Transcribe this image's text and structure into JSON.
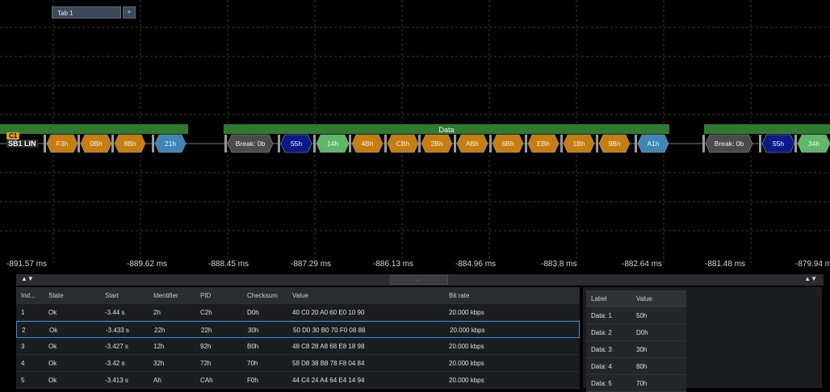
{
  "tabs": {
    "tab1_label": "Tab 1",
    "add_label": "+"
  },
  "channel": {
    "badge": "C1",
    "label": "SB1 LIN"
  },
  "colors": {
    "orange": "#c87d10",
    "blue": "#3f86b8",
    "green": "#2f7a2f",
    "light_green": "#5db86a",
    "navy": "#0a1a8a",
    "gray": "#4b4b4b"
  },
  "bus": {
    "frame_headers": [
      {
        "label": ""
      },
      {
        "label": "Data"
      },
      {
        "label": ""
      }
    ],
    "segments": [
      {
        "text": "F3h",
        "color": "orange"
      },
      {
        "text": "0Bh",
        "color": "orange"
      },
      {
        "text": "8Bh",
        "color": "orange"
      },
      {
        "text": "21h",
        "color": "blue"
      },
      {
        "text": "Break: 0b",
        "color": "gray"
      },
      {
        "text": "55h",
        "color": "navy"
      },
      {
        "text": "14h",
        "color": "light_green"
      },
      {
        "text": "4Bh",
        "color": "orange"
      },
      {
        "text": "CBh",
        "color": "orange"
      },
      {
        "text": "2Bh",
        "color": "orange"
      },
      {
        "text": "ABh",
        "color": "orange"
      },
      {
        "text": "6Bh",
        "color": "orange"
      },
      {
        "text": "EBh",
        "color": "orange"
      },
      {
        "text": "1Bh",
        "color": "orange"
      },
      {
        "text": "9Bh",
        "color": "orange"
      },
      {
        "text": "A1h",
        "color": "blue"
      },
      {
        "text": "Break: 0b",
        "color": "gray"
      },
      {
        "text": "55h",
        "color": "navy"
      },
      {
        "text": "34h",
        "color": "light_green"
      }
    ]
  },
  "time_ticks": [
    "-891.57 ms",
    "-889.62 ms",
    "-888.45 ms",
    "-887.29 ms",
    "-886.13 ms",
    "-884.96 ms",
    "-883.8 ms",
    "-882.64 ms",
    "-881.48 ms",
    "-879.94 ms"
  ],
  "results_table": {
    "columns": [
      "Ind...",
      "State",
      "Start",
      "Identifier",
      "PID",
      "Checksum",
      "Value",
      "Bit rate"
    ],
    "rows": [
      [
        "1",
        "Ok",
        "-3.44 s",
        "2h",
        "C2h",
        "D0h",
        "40 C0 20 A0 60 E0 10 90",
        "20.000 kbps"
      ],
      [
        "2",
        "Ok",
        "-3.433 s",
        "22h",
        "22h",
        "30h",
        "50 D0 30 B0 70 F0 08 88",
        "20.000 kbps"
      ],
      [
        "3",
        "Ok",
        "-3.427 s",
        "12h",
        "92h",
        "B0h",
        "48 C8 28 A8 68 E8 18 98",
        "20.000 kbps"
      ],
      [
        "4",
        "Ok",
        "-3.42 s",
        "32h",
        "72h",
        "70h",
        "58 D8 38 B8 78 F8 04 84",
        "20.000 kbps"
      ],
      [
        "5",
        "Ok",
        "-3.413 s",
        "Ah",
        "CAh",
        "F0h",
        "44 C4 24 A4 64 E4 14 94",
        "20.000 kbps"
      ]
    ],
    "selected_row": 2
  },
  "detail_table": {
    "columns": [
      "Label",
      "Value"
    ],
    "rows": [
      [
        "Data: 1",
        "50h"
      ],
      [
        "Data: 2",
        "D0h"
      ],
      [
        "Data: 3",
        "30h"
      ],
      [
        "Data: 4",
        "80h"
      ],
      [
        "Data: 5",
        "70h"
      ]
    ]
  },
  "splitter": {
    "handle": "....",
    "arrows": "▲▼"
  }
}
